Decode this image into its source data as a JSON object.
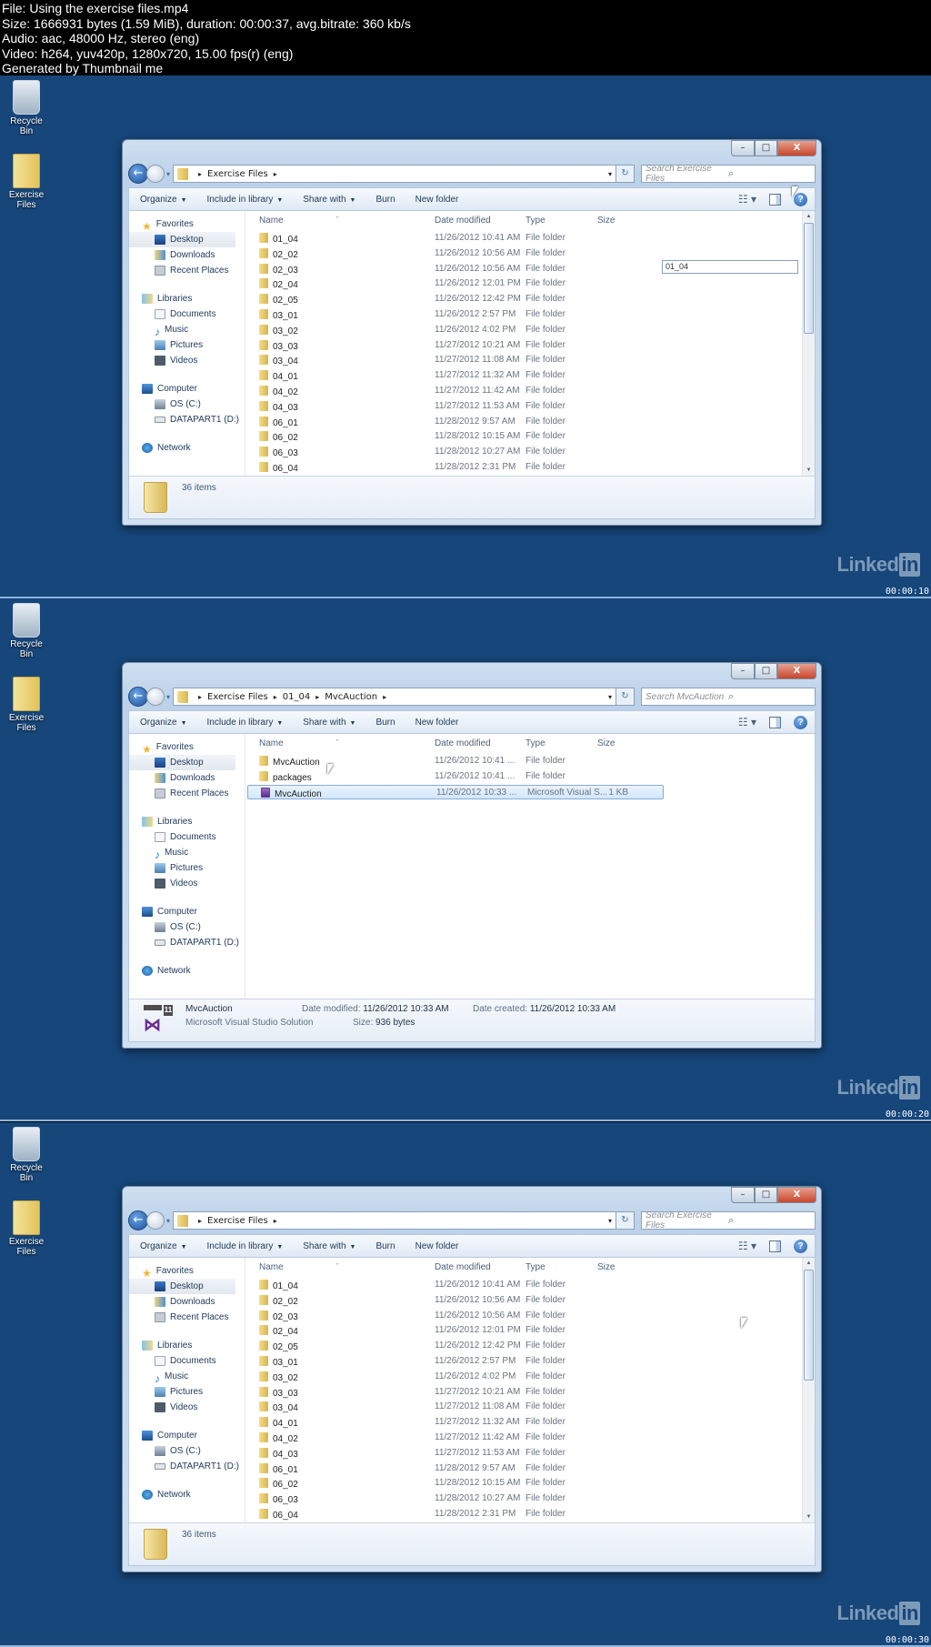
{
  "header": {
    "lines": [
      "File: Using the exercise files.mp4",
      "Size: 1666931 bytes (1.59 MiB), duration: 00:00:37, avg.bitrate: 360 kb/s",
      "Audio: aac, 48000 Hz, stereo (eng)",
      "Video: h264, yuv420p, 1280x720, 15.00 fps(r) (eng)",
      "Generated by Thumbnail me"
    ]
  },
  "desktop": {
    "icons": [
      {
        "label": "Recycle Bin",
        "icon": "recycle-bin-icon"
      },
      {
        "label": "Exercise Files",
        "icon": "folder-icon"
      }
    ],
    "watermark": {
      "text": "Linked",
      "badge": "in"
    },
    "background_color": "#16467a"
  },
  "window_common": {
    "controls": {
      "minimize": "–",
      "maximize": "□",
      "close": "X"
    },
    "nav": {
      "back": "←",
      "history_dropdown": "▾"
    },
    "refresh_icon": "↻",
    "toolbar": {
      "organize": "Organize",
      "include_in_library": "Include in library",
      "share_with": "Share with",
      "burn": "Burn",
      "new_folder": "New folder"
    },
    "columns": {
      "name": "Name",
      "date_modified": "Date modified",
      "type": "Type",
      "size": "Size"
    },
    "navpane": {
      "groups": [
        {
          "label": "Favorites",
          "icon": "star-icon",
          "items": [
            {
              "label": "Desktop",
              "icon": "desktop-icon",
              "selected": true
            },
            {
              "label": "Downloads",
              "icon": "downloads-icon"
            },
            {
              "label": "Recent Places",
              "icon": "recent-places-icon"
            }
          ]
        },
        {
          "label": "Libraries",
          "icon": "libraries-icon",
          "items": [
            {
              "label": "Documents",
              "icon": "documents-icon"
            },
            {
              "label": "Music",
              "icon": "music-icon"
            },
            {
              "label": "Pictures",
              "icon": "pictures-icon"
            },
            {
              "label": "Videos",
              "icon": "videos-icon"
            }
          ]
        },
        {
          "label": "Computer",
          "icon": "computer-icon",
          "items": [
            {
              "label": "OS (C:)",
              "icon": "os-drive-icon"
            },
            {
              "label": "DATAPART1 (D:)",
              "icon": "drive-icon"
            }
          ]
        },
        {
          "label": "Network",
          "icon": "network-icon",
          "items": []
        }
      ]
    }
  },
  "frames": [
    {
      "timecode": "00:00:10",
      "breadcrumb": [
        "Exercise Files"
      ],
      "search_placeholder": "Search Exercise Files",
      "rename_box_value": "01_04",
      "status": {
        "item_count": "36 items"
      },
      "files": [
        {
          "name": "01_04",
          "date": "11/26/2012 10:41 AM",
          "type": "File folder",
          "size": ""
        },
        {
          "name": "02_02",
          "date": "11/26/2012 10:56 AM",
          "type": "File folder",
          "size": ""
        },
        {
          "name": "02_03",
          "date": "11/26/2012 10:56 AM",
          "type": "File folder",
          "size": ""
        },
        {
          "name": "02_04",
          "date": "11/26/2012 12:01 PM",
          "type": "File folder",
          "size": ""
        },
        {
          "name": "02_05",
          "date": "11/26/2012 12:42 PM",
          "type": "File folder",
          "size": ""
        },
        {
          "name": "03_01",
          "date": "11/26/2012 2:57 PM",
          "type": "File folder",
          "size": ""
        },
        {
          "name": "03_02",
          "date": "11/26/2012 4:02 PM",
          "type": "File folder",
          "size": ""
        },
        {
          "name": "03_03",
          "date": "11/27/2012 10:21 AM",
          "type": "File folder",
          "size": ""
        },
        {
          "name": "03_04",
          "date": "11/27/2012 11:08 AM",
          "type": "File folder",
          "size": ""
        },
        {
          "name": "04_01",
          "date": "11/27/2012 11:32 AM",
          "type": "File folder",
          "size": ""
        },
        {
          "name": "04_02",
          "date": "11/27/2012 11:42 AM",
          "type": "File folder",
          "size": ""
        },
        {
          "name": "04_03",
          "date": "11/27/2012 11:53 AM",
          "type": "File folder",
          "size": ""
        },
        {
          "name": "06_01",
          "date": "11/28/2012 9:57 AM",
          "type": "File folder",
          "size": ""
        },
        {
          "name": "06_02",
          "date": "11/28/2012 10:15 AM",
          "type": "File folder",
          "size": ""
        },
        {
          "name": "06_03",
          "date": "11/28/2012 10:27 AM",
          "type": "File folder",
          "size": ""
        },
        {
          "name": "06_04",
          "date": "11/28/2012 2:31 PM",
          "type": "File folder",
          "size": ""
        }
      ]
    },
    {
      "timecode": "00:00:20",
      "breadcrumb": [
        "Exercise Files",
        "01_04",
        "MvcAuction"
      ],
      "search_placeholder": "Search MvcAuction",
      "files": [
        {
          "name": "MvcAuction",
          "date": "11/26/2012 10:41 ...",
          "type": "File folder",
          "size": "",
          "kind": "folder"
        },
        {
          "name": "packages",
          "date": "11/26/2012 10:41 ...",
          "type": "File folder",
          "size": "",
          "kind": "folder"
        },
        {
          "name": "MvcAuction",
          "date": "11/26/2012 10:33 ...",
          "type": "Microsoft Visual S...",
          "size": "1 KB",
          "kind": "solution",
          "selected": true
        }
      ],
      "details": {
        "name": "MvcAuction",
        "type": "Microsoft Visual Studio Solution",
        "date_modified_label": "Date modified:",
        "date_modified": "11/26/2012 10:33 AM",
        "date_created_label": "Date created:",
        "date_created": "11/26/2012 10:33 AM",
        "size_label": "Size:",
        "size": "936 bytes",
        "icon_badge": "11"
      }
    },
    {
      "timecode": "00:00:30",
      "breadcrumb": [
        "Exercise Files"
      ],
      "search_placeholder": "Search Exercise Files",
      "status": {
        "item_count": "36 items"
      },
      "files": [
        {
          "name": "01_04",
          "date": "11/26/2012 10:41 AM",
          "type": "File folder",
          "size": ""
        },
        {
          "name": "02_02",
          "date": "11/26/2012 10:56 AM",
          "type": "File folder",
          "size": ""
        },
        {
          "name": "02_03",
          "date": "11/26/2012 10:56 AM",
          "type": "File folder",
          "size": ""
        },
        {
          "name": "02_04",
          "date": "11/26/2012 12:01 PM",
          "type": "File folder",
          "size": ""
        },
        {
          "name": "02_05",
          "date": "11/26/2012 12:42 PM",
          "type": "File folder",
          "size": ""
        },
        {
          "name": "03_01",
          "date": "11/26/2012 2:57 PM",
          "type": "File folder",
          "size": ""
        },
        {
          "name": "03_02",
          "date": "11/26/2012 4:02 PM",
          "type": "File folder",
          "size": ""
        },
        {
          "name": "03_03",
          "date": "11/27/2012 10:21 AM",
          "type": "File folder",
          "size": ""
        },
        {
          "name": "03_04",
          "date": "11/27/2012 11:08 AM",
          "type": "File folder",
          "size": ""
        },
        {
          "name": "04_01",
          "date": "11/27/2012 11:32 AM",
          "type": "File folder",
          "size": ""
        },
        {
          "name": "04_02",
          "date": "11/27/2012 11:42 AM",
          "type": "File folder",
          "size": ""
        },
        {
          "name": "04_03",
          "date": "11/27/2012 11:53 AM",
          "type": "File folder",
          "size": ""
        },
        {
          "name": "06_01",
          "date": "11/28/2012 9:57 AM",
          "type": "File folder",
          "size": ""
        },
        {
          "name": "06_02",
          "date": "11/28/2012 10:15 AM",
          "type": "File folder",
          "size": ""
        },
        {
          "name": "06_03",
          "date": "11/28/2012 10:27 AM",
          "type": "File folder",
          "size": ""
        },
        {
          "name": "06_04",
          "date": "11/28/2012 2:31 PM",
          "type": "File folder",
          "size": ""
        }
      ]
    }
  ]
}
